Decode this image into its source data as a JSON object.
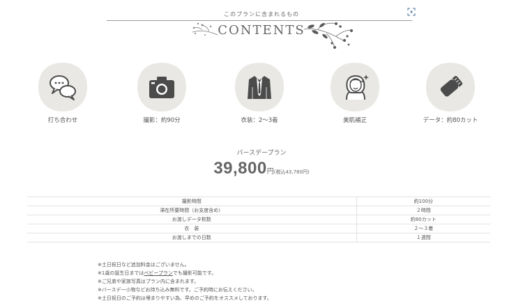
{
  "header": {
    "caption": "このプランに含まれるもの",
    "title": "CONTENTS",
    "icons": {
      "expand": "expand-icon",
      "floral_left": "floral-icon",
      "floral_right": "floral-icon"
    }
  },
  "items": [
    {
      "label": "打ち合わせ",
      "icon": "chat-bubbles-icon"
    },
    {
      "label": "撮影：約90分",
      "icon": "camera-icon"
    },
    {
      "label": "衣装：2〜3着",
      "icon": "suit-jacket-icon"
    },
    {
      "label": "美肌補正",
      "icon": "face-sparkle-icon"
    },
    {
      "label": "データ：約80カット",
      "icon": "sd-card-icon"
    }
  ],
  "plan": {
    "name": "バースデープラン",
    "price": "39,800",
    "yen": "円",
    "tax": "(税込43,780円)"
  },
  "spec_rows": [
    {
      "key": "撮影時間",
      "value": "約100分"
    },
    {
      "key": "滞在所要時間（お支度含め）",
      "value": "２時間"
    },
    {
      "key": "お渡しデータ枚数",
      "value": "約80カット"
    },
    {
      "key": "衣　装",
      "value": "２～３着"
    },
    {
      "key": "お渡しまでの日数",
      "value": "１週間"
    }
  ],
  "notes": {
    "line1": "※土日祝日など追加料金はございません。",
    "line2_before": "※1歳の誕生日までは",
    "line2_link": "ベビープラン",
    "line2_after": "でも撮影可能です。",
    "line3": "※ご兄弟や家族写真はプラン内に含まれます。",
    "line4": "※バースデー小物などお持ち込み無料です。ご予約時にお伝えください。",
    "line5": "※土日祝日のご予約は埋まりやすい為、早めのご予約をオススメしております。"
  },
  "colors": {
    "circle_bg": "#e9e8e4",
    "icon": "#4b4b4b",
    "text": "#555555"
  }
}
